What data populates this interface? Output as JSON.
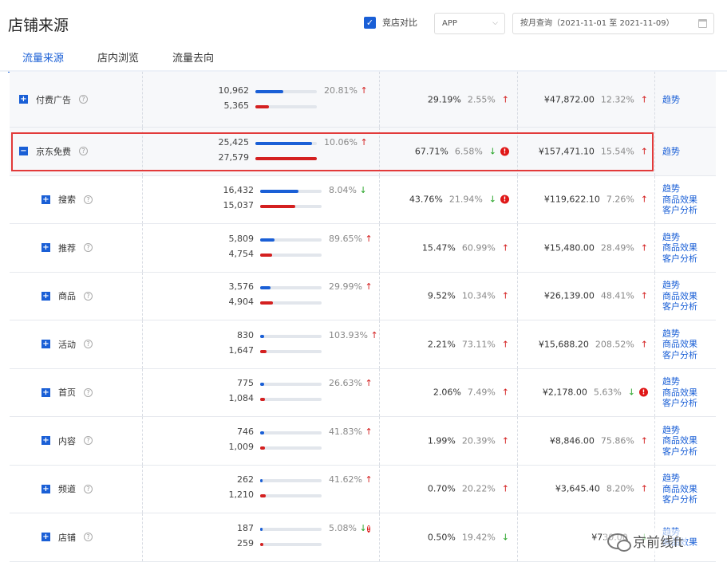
{
  "header": {
    "title": "店铺来源",
    "compare_label": "竞店对比",
    "platform": "APP",
    "date_range": "按月查询（2021-11-01 至 2021-11-09）"
  },
  "tabs": [
    {
      "label": "流量来源",
      "active": true
    },
    {
      "label": "店内浏览",
      "active": false
    },
    {
      "label": "流量去向",
      "active": false
    }
  ],
  "rows": [
    {
      "name": "付费广告",
      "expand": "+",
      "n1": "10,962",
      "n2": "5,365",
      "f1": 0.45,
      "f2": 0.22,
      "pct1": "20.81%",
      "dir1": "up",
      "warn1": false,
      "rate": "29.19%",
      "rate_sub": "2.55%",
      "dir2": "up",
      "warn2": false,
      "amount": "¥47,872.00",
      "amount_sub": "12.32%",
      "dir3": "up",
      "warn3": false,
      "links": [
        "趋势"
      ]
    },
    {
      "name": "京东免费",
      "expand": "−",
      "n1": "25,425",
      "n2": "27,579",
      "f1": 0.92,
      "f2": 1.0,
      "pct1": "10.06%",
      "dir1": "up",
      "warn1": false,
      "rate": "67.71%",
      "rate_sub": "6.58%",
      "dir2": "down",
      "warn2": true,
      "amount": "¥157,471.10",
      "amount_sub": "15.54%",
      "dir3": "up",
      "warn3": false,
      "links": [
        "趋势"
      ]
    },
    {
      "name": "搜索",
      "expand": "+",
      "n1": "16,432",
      "n2": "15,037",
      "f1": 0.62,
      "f2": 0.57,
      "pct1": "8.04%",
      "dir1": "down",
      "warn1": false,
      "rate": "43.76%",
      "rate_sub": "21.94%",
      "dir2": "down",
      "warn2": true,
      "amount": "¥119,622.10",
      "amount_sub": "7.26%",
      "dir3": "up",
      "warn3": false,
      "links": [
        "趋势",
        "商品效果",
        "客户分析"
      ]
    },
    {
      "name": "推荐",
      "expand": "+",
      "n1": "5,809",
      "n2": "4,754",
      "f1": 0.24,
      "f2": 0.19,
      "pct1": "89.65%",
      "dir1": "up",
      "warn1": false,
      "rate": "15.47%",
      "rate_sub": "60.99%",
      "dir2": "up",
      "warn2": false,
      "amount": "¥15,480.00",
      "amount_sub": "28.49%",
      "dir3": "up",
      "warn3": false,
      "links": [
        "趋势",
        "商品效果",
        "客户分析"
      ]
    },
    {
      "name": "商品",
      "expand": "+",
      "n1": "3,576",
      "n2": "4,904",
      "f1": 0.17,
      "f2": 0.21,
      "pct1": "29.99%",
      "dir1": "up",
      "warn1": false,
      "rate": "9.52%",
      "rate_sub": "10.34%",
      "dir2": "up",
      "warn2": false,
      "amount": "¥26,139.00",
      "amount_sub": "48.41%",
      "dir3": "up",
      "warn3": false,
      "links": [
        "趋势",
        "商品效果",
        "客户分析"
      ]
    },
    {
      "name": "活动",
      "expand": "+",
      "n1": "830",
      "n2": "1,647",
      "f1": 0.06,
      "f2": 0.1,
      "pct1": "103.93%",
      "dir1": "up",
      "warn1": false,
      "rate": "2.21%",
      "rate_sub": "73.11%",
      "dir2": "up",
      "warn2": false,
      "amount": "¥15,688.20",
      "amount_sub": "208.52%",
      "dir3": "up",
      "warn3": false,
      "links": [
        "趋势",
        "商品效果",
        "客户分析"
      ]
    },
    {
      "name": "首页",
      "expand": "+",
      "n1": "775",
      "n2": "1,084",
      "f1": 0.07,
      "f2": 0.08,
      "pct1": "26.63%",
      "dir1": "up",
      "warn1": false,
      "rate": "2.06%",
      "rate_sub": "7.49%",
      "dir2": "up",
      "warn2": false,
      "amount": "¥2,178.00",
      "amount_sub": "5.63%",
      "dir3": "down",
      "warn3": true,
      "links": [
        "趋势",
        "商品效果",
        "客户分析"
      ]
    },
    {
      "name": "内容",
      "expand": "+",
      "n1": "746",
      "n2": "1,009",
      "f1": 0.07,
      "f2": 0.08,
      "pct1": "41.83%",
      "dir1": "up",
      "warn1": false,
      "rate": "1.99%",
      "rate_sub": "20.39%",
      "dir2": "up",
      "warn2": false,
      "amount": "¥8,846.00",
      "amount_sub": "75.86%",
      "dir3": "up",
      "warn3": false,
      "links": [
        "趋势",
        "商品效果",
        "客户分析"
      ]
    },
    {
      "name": "频道",
      "expand": "+",
      "n1": "262",
      "n2": "1,210",
      "f1": 0.04,
      "f2": 0.09,
      "pct1": "41.62%",
      "dir1": "up",
      "warn1": false,
      "rate": "0.70%",
      "rate_sub": "20.22%",
      "dir2": "up",
      "warn2": false,
      "amount": "¥3,645.40",
      "amount_sub": "8.20%",
      "dir3": "up",
      "warn3": false,
      "links": [
        "趋势",
        "商品效果",
        "客户分析"
      ]
    },
    {
      "name": "店铺",
      "expand": "+",
      "n1": "187",
      "n2": "259",
      "f1": 0.04,
      "f2": 0.05,
      "pct1": "5.08%",
      "dir1": "down",
      "warn1": true,
      "rate": "0.50%",
      "rate_sub": "19.42%",
      "dir2": "down",
      "warn2": false,
      "amount": "¥730.00",
      "amount_sub": "",
      "dir3": "down",
      "warn3": false,
      "links": [
        "趋势",
        "商品效果"
      ]
    }
  ],
  "watermark": "京前线ft",
  "colors": {
    "accent": "#1a5fd6",
    "negative": "#d42020",
    "positive": "#2aa52a"
  }
}
